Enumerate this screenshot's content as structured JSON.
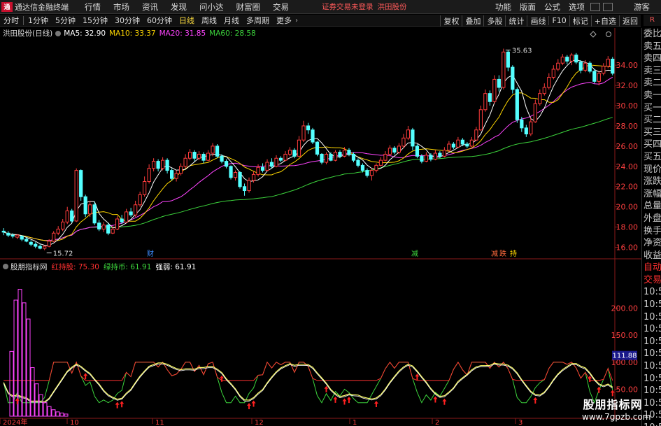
{
  "app": {
    "title": "通达信金融终端",
    "menu": [
      "行情",
      "市场",
      "资讯",
      "发现",
      "问小达",
      "财富圈",
      "交易"
    ],
    "notice": "证券交易未登录",
    "stock_name": "洪田股份",
    "right_menu": [
      "功能",
      "版面",
      "公式",
      "选项"
    ],
    "guest": "游客",
    "badge": "R"
  },
  "period_tabs": [
    {
      "label": "分时",
      "active": false
    },
    {
      "label": "1分钟",
      "active": false
    },
    {
      "label": "5分钟",
      "active": false
    },
    {
      "label": "15分钟",
      "active": false
    },
    {
      "label": "30分钟",
      "active": false
    },
    {
      "label": "60分钟",
      "active": false
    },
    {
      "label": "日线",
      "active": true
    },
    {
      "label": "周线",
      "active": false
    },
    {
      "label": "月线",
      "active": false
    },
    {
      "label": "多周期",
      "active": false
    },
    {
      "label": "更多",
      "active": false
    }
  ],
  "tools": [
    "复权",
    "叠加",
    "多股",
    "统计",
    "画线",
    "F10",
    "标记",
    "+自选",
    "返回"
  ],
  "ma_legend": {
    "name": "洪田股份(日线)",
    "items": [
      {
        "label": "MA5: 32.90",
        "color": "#ffffff"
      },
      {
        "label": "MA10: 33.37",
        "color": "#ffd700"
      },
      {
        "label": "MA20: 31.85",
        "color": "#ff44ff"
      },
      {
        "label": "MA60: 28.58",
        "color": "#3cd43c"
      }
    ]
  },
  "indicator_legend": {
    "name": "股朋指标网",
    "items": [
      {
        "label": "红持股: 75.30",
        "color": "#ff3030"
      },
      {
        "label": "绿持币: 61.91",
        "color": "#3cd43c"
      },
      {
        "label": "强弱: 61.91",
        "color": "#ffffff"
      }
    ]
  },
  "chart_data": [
    {
      "type": "candlestick",
      "price_axis": {
        "ticks": [
          16.0,
          18.0,
          20.0,
          22.0,
          24.0,
          26.0,
          28.0,
          30.0,
          32.0,
          34.0
        ],
        "ylim": [
          15.0,
          36.5
        ]
      },
      "annotations": {
        "high": "35.63",
        "low": "15.72",
        "event_labels": [
          "财",
          "减",
          "减",
          "跌",
          "持"
        ]
      },
      "candles": [
        [
          17.6,
          17.5,
          17.9,
          17.2
        ],
        [
          17.4,
          17.2,
          17.6,
          17.0
        ],
        [
          17.2,
          17.1,
          17.4,
          16.9
        ],
        [
          17.0,
          17.2,
          17.3,
          16.8
        ],
        [
          17.1,
          16.8,
          17.2,
          16.6
        ],
        [
          16.8,
          16.6,
          17.0,
          16.5
        ],
        [
          16.5,
          16.3,
          16.7,
          16.1
        ],
        [
          16.3,
          16.1,
          16.5,
          15.9
        ],
        [
          16.1,
          15.9,
          16.3,
          15.8
        ],
        [
          15.9,
          16.1,
          16.2,
          15.72
        ],
        [
          16.1,
          16.6,
          16.8,
          16.0
        ],
        [
          16.6,
          17.4,
          17.6,
          16.5
        ],
        [
          17.4,
          17.8,
          18.1,
          17.2
        ],
        [
          17.8,
          18.5,
          18.8,
          17.6
        ],
        [
          18.5,
          19.6,
          20.0,
          18.3
        ],
        [
          19.6,
          18.6,
          19.8,
          18.4
        ],
        [
          18.6,
          23.6,
          23.8,
          18.5
        ],
        [
          23.6,
          21.0,
          23.7,
          20.6
        ],
        [
          21.0,
          19.3,
          21.2,
          19.0
        ],
        [
          19.3,
          20.2,
          20.6,
          19.0
        ],
        [
          20.2,
          18.4,
          20.5,
          18.2
        ],
        [
          18.4,
          17.8,
          18.7,
          17.6
        ],
        [
          17.8,
          18.2,
          18.5,
          17.5
        ],
        [
          18.2,
          17.4,
          18.4,
          17.2
        ],
        [
          17.4,
          17.8,
          18.1,
          17.3
        ],
        [
          17.8,
          18.8,
          19.1,
          17.7
        ],
        [
          18.8,
          18.5,
          19.2,
          18.3
        ],
        [
          18.5,
          19.5,
          19.8,
          18.4
        ],
        [
          19.5,
          19.2,
          19.9,
          19.0
        ],
        [
          19.2,
          20.2,
          20.6,
          19.0
        ],
        [
          20.2,
          21.2,
          21.5,
          20.0
        ],
        [
          21.2,
          22.5,
          23.0,
          21.0
        ],
        [
          22.5,
          23.8,
          24.2,
          22.3
        ],
        [
          23.8,
          24.5,
          24.8,
          23.5
        ],
        [
          24.5,
          23.8,
          24.7,
          23.5
        ],
        [
          23.8,
          24.6,
          24.9,
          23.6
        ],
        [
          24.6,
          23.6,
          24.8,
          23.3
        ],
        [
          23.6,
          22.8,
          23.8,
          22.6
        ],
        [
          22.8,
          23.3,
          23.6,
          22.5
        ],
        [
          23.3,
          24.0,
          24.3,
          23.1
        ],
        [
          24.0,
          24.8,
          25.2,
          23.8
        ],
        [
          24.8,
          25.4,
          25.7,
          24.6
        ],
        [
          25.4,
          24.8,
          25.6,
          24.5
        ],
        [
          24.8,
          25.2,
          25.5,
          24.6
        ],
        [
          25.2,
          24.6,
          25.4,
          24.3
        ],
        [
          24.6,
          25.3,
          25.6,
          24.5
        ],
        [
          25.3,
          26.0,
          26.3,
          25.0
        ],
        [
          26.0,
          25.0,
          26.2,
          24.8
        ],
        [
          25.0,
          24.5,
          25.2,
          24.3
        ],
        [
          24.5,
          24.0,
          24.7,
          23.8
        ],
        [
          24.0,
          22.9,
          24.1,
          22.7
        ],
        [
          22.9,
          23.4,
          23.6,
          22.6
        ],
        [
          23.4,
          22.0,
          23.5,
          21.8
        ],
        [
          22.0,
          21.6,
          22.3,
          21.1
        ],
        [
          21.6,
          22.6,
          22.9,
          21.4
        ],
        [
          22.6,
          23.2,
          23.5,
          22.4
        ],
        [
          23.2,
          23.9,
          24.2,
          23.0
        ],
        [
          23.9,
          23.6,
          24.3,
          23.4
        ],
        [
          23.6,
          24.4,
          24.7,
          23.5
        ],
        [
          24.4,
          24.0,
          24.8,
          23.8
        ],
        [
          24.0,
          24.8,
          25.1,
          23.9
        ],
        [
          24.8,
          24.6,
          25.0,
          24.4
        ],
        [
          24.6,
          25.2,
          25.5,
          24.5
        ],
        [
          25.2,
          25.6,
          25.9,
          25.0
        ],
        [
          25.6,
          25.0,
          25.8,
          24.8
        ],
        [
          25.0,
          26.6,
          27.0,
          24.9
        ],
        [
          26.6,
          28.0,
          28.5,
          26.4
        ],
        [
          28.0,
          27.6,
          28.3,
          27.2
        ],
        [
          27.6,
          26.4,
          27.8,
          26.2
        ],
        [
          26.4,
          25.2,
          26.5,
          25.0
        ],
        [
          25.2,
          24.4,
          25.3,
          24.2
        ],
        [
          24.4,
          25.2,
          25.4,
          24.2
        ],
        [
          25.2,
          24.6,
          25.4,
          24.5
        ],
        [
          24.6,
          25.4,
          25.6,
          24.5
        ],
        [
          25.4,
          25.0,
          25.6,
          24.8
        ],
        [
          25.0,
          25.6,
          25.9,
          24.9
        ],
        [
          25.6,
          25.2,
          25.8,
          25.0
        ],
        [
          25.2,
          24.6,
          25.4,
          24.4
        ],
        [
          24.6,
          24.1,
          24.8,
          23.9
        ],
        [
          24.1,
          23.6,
          24.3,
          23.4
        ],
        [
          23.6,
          23.1,
          23.8,
          22.9
        ],
        [
          23.1,
          23.6,
          23.8,
          22.6
        ],
        [
          23.6,
          24.1,
          24.3,
          23.4
        ],
        [
          24.1,
          24.6,
          24.9,
          24.0
        ],
        [
          24.6,
          25.2,
          25.5,
          24.5
        ],
        [
          25.2,
          25.8,
          26.1,
          25.0
        ],
        [
          25.8,
          25.4,
          26.0,
          25.2
        ],
        [
          25.4,
          26.0,
          26.3,
          25.2
        ],
        [
          26.0,
          26.8,
          27.2,
          25.8
        ],
        [
          26.8,
          27.6,
          28.0,
          26.6
        ],
        [
          27.6,
          26.0,
          27.8,
          25.6
        ],
        [
          26.0,
          25.0,
          26.2,
          24.8
        ],
        [
          25.0,
          24.5,
          25.2,
          24.3
        ],
        [
          24.5,
          25.1,
          25.4,
          24.4
        ],
        [
          25.1,
          24.7,
          25.3,
          24.5
        ],
        [
          24.7,
          25.3,
          25.6,
          24.6
        ],
        [
          25.3,
          25.0,
          25.5,
          24.8
        ],
        [
          25.0,
          25.6,
          25.9,
          24.9
        ],
        [
          25.6,
          26.2,
          26.5,
          25.4
        ],
        [
          26.2,
          25.9,
          26.4,
          25.7
        ],
        [
          25.9,
          26.6,
          26.9,
          25.8
        ],
        [
          26.6,
          26.2,
          26.8,
          26.0
        ],
        [
          26.2,
          26.0,
          26.4,
          25.8
        ],
        [
          26.0,
          26.6,
          26.9,
          25.9
        ],
        [
          26.6,
          27.6,
          27.9,
          26.5
        ],
        [
          27.6,
          29.6,
          30.0,
          27.5
        ],
        [
          29.6,
          31.2,
          31.6,
          29.4
        ],
        [
          31.2,
          30.4,
          31.5,
          30.0
        ],
        [
          30.4,
          32.6,
          33.0,
          30.2
        ],
        [
          32.6,
          31.8,
          33.0,
          31.4
        ],
        [
          31.8,
          35.3,
          35.63,
          31.6
        ],
        [
          35.3,
          33.8,
          35.5,
          33.4
        ],
        [
          33.8,
          31.6,
          34.0,
          31.2
        ],
        [
          31.6,
          28.6,
          31.8,
          28.3
        ],
        [
          28.6,
          27.8,
          28.9,
          27.4
        ],
        [
          27.8,
          27.2,
          28.1,
          26.9
        ],
        [
          27.2,
          28.4,
          28.8,
          27.0
        ],
        [
          28.4,
          30.2,
          30.6,
          28.3
        ],
        [
          30.2,
          31.2,
          31.6,
          30.0
        ],
        [
          31.2,
          31.8,
          32.2,
          31.0
        ],
        [
          31.8,
          32.8,
          33.2,
          31.6
        ],
        [
          32.8,
          33.6,
          34.0,
          32.6
        ],
        [
          33.6,
          34.2,
          34.6,
          33.4
        ],
        [
          34.2,
          34.8,
          35.1,
          34.0
        ],
        [
          34.8,
          34.4,
          35.0,
          34.1
        ],
        [
          34.4,
          35.0,
          35.2,
          34.0
        ],
        [
          35.0,
          34.3,
          35.2,
          34.1
        ],
        [
          34.3,
          33.5,
          34.5,
          33.2
        ],
        [
          33.5,
          34.2,
          34.5,
          33.3
        ],
        [
          34.2,
          33.4,
          34.4,
          33.2
        ],
        [
          33.4,
          32.4,
          33.6,
          32.2
        ],
        [
          32.4,
          33.2,
          33.4,
          32.0
        ],
        [
          33.2,
          33.9,
          34.2,
          33.0
        ],
        [
          33.9,
          34.6,
          34.9,
          33.7
        ],
        [
          34.6,
          33.2,
          34.8,
          33.0
        ]
      ]
    },
    {
      "type": "line",
      "name": "股朋指标网",
      "y_axis_ticks": [
        50.0,
        100.0,
        150.0,
        200.0
      ],
      "ylim": [
        0,
        250
      ],
      "marker_value": "111.88",
      "x_labels": [
        "2024年",
        "10",
        "11",
        "12",
        "1",
        "2",
        "3"
      ]
    }
  ],
  "side_panel": [
    "委比",
    "卖五",
    "卖四",
    "卖三",
    "卖二",
    "卖一",
    "买一",
    "买二",
    "买三",
    "买四",
    "买五",
    "现价",
    "涨跌",
    "涨幅",
    "总量",
    "外盘",
    "换手",
    "净资",
    "收益",
    "自动",
    "交易",
    "10:57",
    "10:57",
    "10:57",
    "10:57",
    "10:57",
    "10:57",
    "10:57",
    "10:57",
    "10:57",
    "10:57",
    "10:57",
    "10:57"
  ],
  "watermark": {
    "title": "股朋指标网",
    "url": "www.7gpzb.com"
  }
}
